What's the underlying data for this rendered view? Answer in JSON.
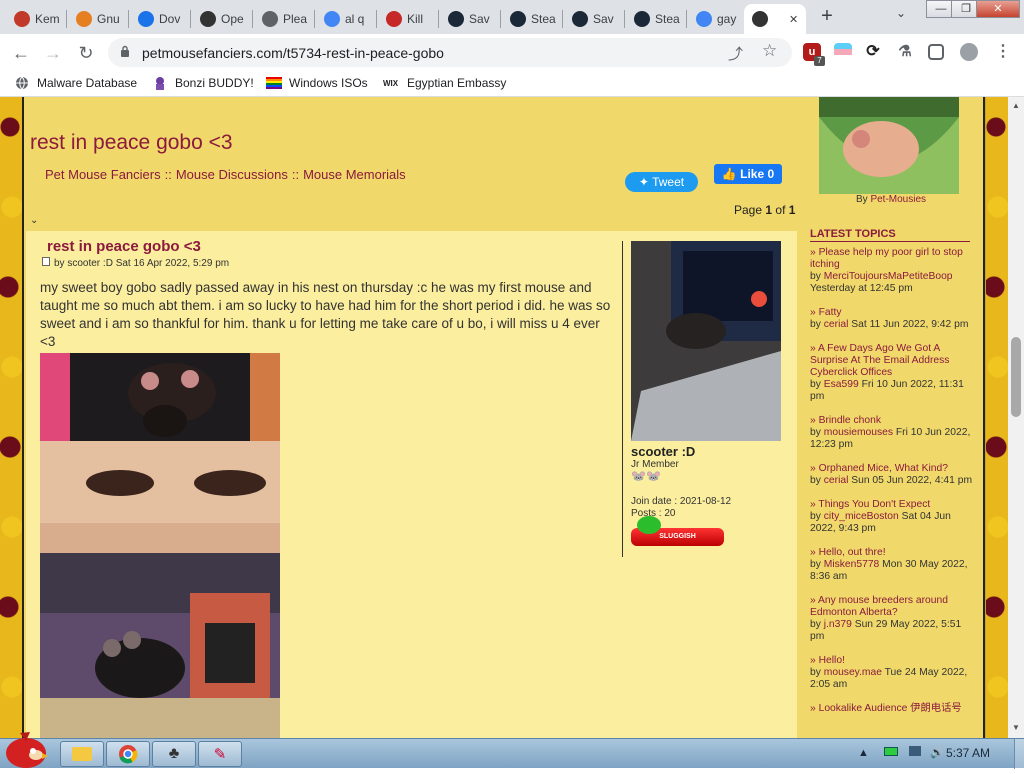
{
  "browser": {
    "tabs": [
      {
        "label": "Kem",
        "icon": "fox-icon",
        "color": "#c0392b"
      },
      {
        "label": "Gnu",
        "icon": "diamond-icon",
        "color": "#e67e22"
      },
      {
        "label": "Dov",
        "icon": "download-icon",
        "color": "#1a73e8"
      },
      {
        "label": "Ope",
        "icon": "wordpress-icon",
        "color": "#333333"
      },
      {
        "label": "Plea",
        "icon": "globe-icon",
        "color": "#5f6368"
      },
      {
        "label": "al q",
        "icon": "google-icon",
        "color": "#4285f4"
      },
      {
        "label": "Kill",
        "icon": "kill-icon",
        "color": "#c62828"
      },
      {
        "label": "Sav",
        "icon": "steam-icon",
        "color": "#1b2838"
      },
      {
        "label": "Stea",
        "icon": "steam-icon",
        "color": "#1b2838"
      },
      {
        "label": "Sav",
        "icon": "steam-icon",
        "color": "#1b2838"
      },
      {
        "label": "Stea",
        "icon": "steam-icon",
        "color": "#1b2838"
      },
      {
        "label": "gay",
        "icon": "google-icon",
        "color": "#4285f4"
      },
      {
        "label": "",
        "icon": "mouse-icon",
        "color": "#333333"
      }
    ],
    "new_tab": "+",
    "tab_menu": "⌄",
    "window_controls": {
      "minimize": "—",
      "maximize": "❐",
      "close": "✕"
    },
    "url": "petmousefanciers.com/t5734-rest-in-peace-gobo",
    "extension_badge": "7",
    "bookmarks": [
      {
        "label": "Malware Database",
        "icon": "globe-icon"
      },
      {
        "label": "Bonzi BUDDY!",
        "icon": "bonzi-icon"
      },
      {
        "label": "Windows ISOs",
        "icon": "rainbow-flag-icon"
      },
      {
        "label": "Egyptian Embassy",
        "icon": "wix-icon"
      }
    ],
    "bookmark_wix": "WIX"
  },
  "page": {
    "title": "rest in peace gobo <3",
    "breadcrumb": [
      "Pet Mouse Fanciers",
      "Mouse Discussions",
      "Mouse Memorials"
    ],
    "breadcrumb_sep": "::",
    "tweet_label": "Tweet",
    "like_label": "Like 0",
    "pagination": {
      "prefix": "Page",
      "current": "1",
      "of": "of",
      "total": "1"
    }
  },
  "post": {
    "title": "rest in peace gobo <3",
    "meta": "by scooter :D Sat 16 Apr 2022, 5:29 pm",
    "body": "my sweet boy gobo sadly passed away in his nest on thursday :c he was my first mouse and taught me so much abt them. i am so lucky to have had him for the short period i did. he was so sweet and i am so thankful for him. thank u for letting me take care of u bo, i will miss u 4 ever <3"
  },
  "author": {
    "name": "scooter :D",
    "rank": "Jr Member",
    "badge": "🐭🐭",
    "join_date": "Join date : 2021-08-12",
    "posts": "Posts : 20",
    "status_label": "SLUGGISH"
  },
  "sidebar": {
    "image_caption_prefix": "By",
    "image_caption_user": "Pet-Mousies",
    "latest_heading": "LATEST TOPICS",
    "topics": [
      {
        "title": "» Please help my poor girl to stop itching",
        "user": "MerciToujoursMaPetiteBoop",
        "date": "Yesterday at 12:45 pm"
      },
      {
        "title": "» Fatty",
        "user": "cerial",
        "date": "Sat 11 Jun 2022, 9:42 pm"
      },
      {
        "title": "» A Few Days Ago We Got A Surprise At The Email Address Cyberclick Offices",
        "user": "Esa599",
        "date": "Fri 10 Jun 2022, 11:31 pm"
      },
      {
        "title": "» Brindle chonk",
        "user": "mousiemouses",
        "date": "Fri 10 Jun 2022, 12:23 pm"
      },
      {
        "title": "» Orphaned Mice, What Kind?",
        "user": "cerial",
        "date": "Sun 05 Jun 2022, 4:41 pm"
      },
      {
        "title": "» Things You Don't Expect",
        "user": "city_miceBoston",
        "date": "Sat 04 Jun 2022, 9:43 pm"
      },
      {
        "title": "» Hello, out thre!",
        "user": "Misken5778",
        "date": "Mon 30 May 2022, 8:36 am"
      },
      {
        "title": "» Any mouse breeders around Edmonton Alberta?",
        "user": "j.n379",
        "date": "Sun 29 May 2022, 5:51 pm"
      },
      {
        "title": "» Hello!",
        "user": "mousey.mae",
        "date": "Tue 24 May 2022, 2:05 am"
      },
      {
        "title": "» Lookalike Audience 伊朗电话号",
        "user": "",
        "date": ""
      }
    ],
    "by_word": "by"
  },
  "taskbar": {
    "clock": "5:37 AM",
    "tray_arrow": "▲"
  }
}
